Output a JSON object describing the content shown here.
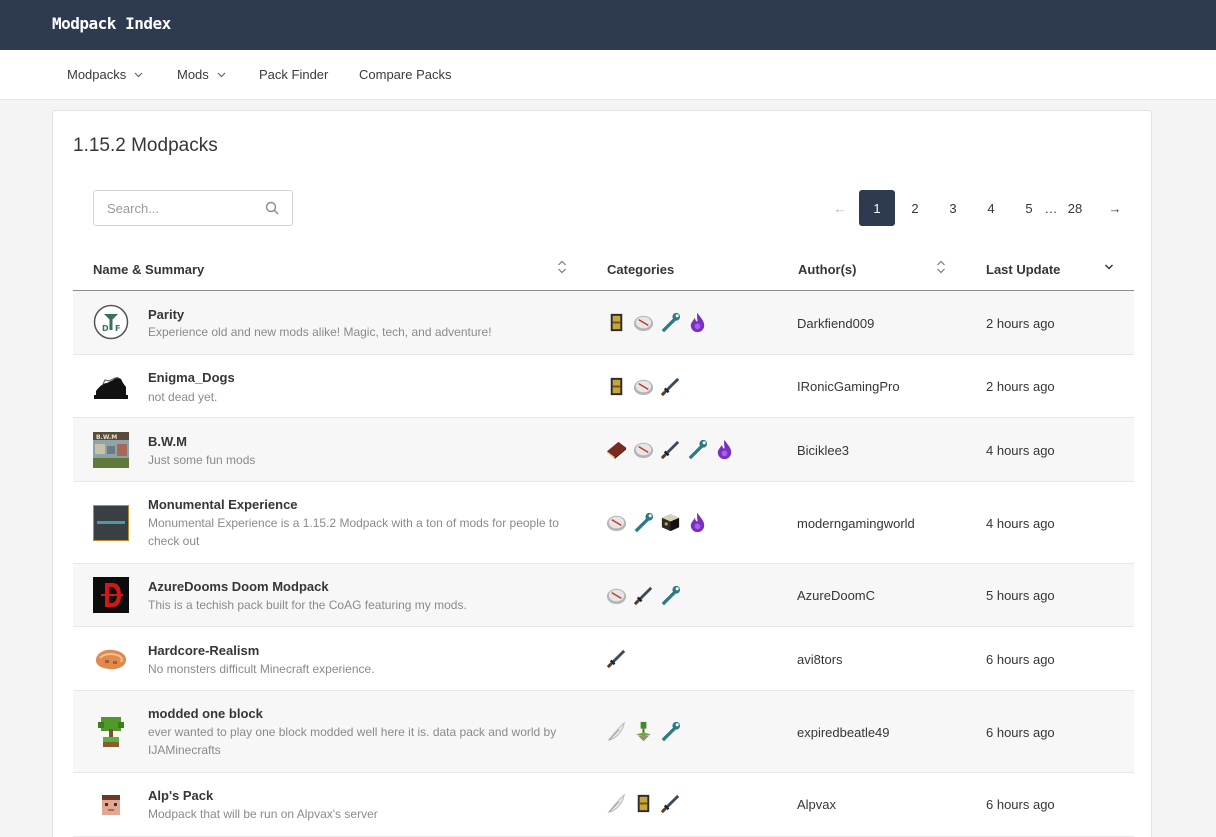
{
  "brand": {
    "logo": "Modpack Index"
  },
  "nav": {
    "modpacks": "Modpacks",
    "mods": "Mods",
    "pack_finder": "Pack Finder",
    "compare": "Compare Packs"
  },
  "page": {
    "title": "1.15.2 Modpacks"
  },
  "search": {
    "placeholder": "Search..."
  },
  "pagination": {
    "prev": "←",
    "pages": [
      "1",
      "2",
      "3",
      "4",
      "5"
    ],
    "ellipsis": "…",
    "last": "28",
    "next": "→",
    "current": "1"
  },
  "table": {
    "columns": {
      "name": "Name & Summary",
      "categories": "Categories",
      "authors": "Author(s)",
      "updated": "Last Update"
    },
    "rows": [
      {
        "name": "Parity",
        "summary": "Experience old and new mods alike! Magic, tech, and adventure!",
        "author": "Darkfiend009",
        "updated": "2 hours ago",
        "categories": [
          "chest-icon",
          "compass-icon",
          "wrench-icon",
          "magic-flame-icon"
        ]
      },
      {
        "name": "Enigma_Dogs",
        "summary": "not dead yet.",
        "author": "IRonicGamingPro",
        "updated": "2 hours ago",
        "categories": [
          "chest-icon",
          "compass-icon",
          "sword-icon"
        ]
      },
      {
        "name": "B.W.M",
        "summary": "Just some fun mods",
        "author": "Biciklee3",
        "updated": "4 hours ago",
        "categories": [
          "book-icon",
          "compass-icon",
          "sword-icon",
          "wrench-icon",
          "magic-flame-icon"
        ]
      },
      {
        "name": "Monumental Experience",
        "summary": "Monumental Experience is a 1.15.2 Modpack with a ton of mods for people to check out",
        "author": "moderngamingworld",
        "updated": "4 hours ago",
        "categories": [
          "compass-icon",
          "wrench-icon",
          "crafting-block-icon",
          "magic-flame-icon"
        ]
      },
      {
        "name": "AzureDooms Doom Modpack",
        "summary": "This is a techish pack built for the CoAG featuring my mods.",
        "author": "AzureDoomC",
        "updated": "5 hours ago",
        "categories": [
          "compass-icon",
          "sword-icon",
          "wrench-icon"
        ]
      },
      {
        "name": "Hardcore-Realism",
        "summary": "No monsters difficult Minecraft experience.",
        "author": "avi8tors",
        "updated": "6 hours ago",
        "categories": [
          "sword-icon"
        ]
      },
      {
        "name": "modded one block",
        "summary": "ever wanted to play one block modded well here it is. data pack and world by IJAMinecrafts",
        "author": "expiredbeatle49",
        "updated": "6 hours ago",
        "categories": [
          "feather-icon",
          "skyblock-island-icon",
          "wrench-icon"
        ]
      },
      {
        "name": "Alp's Pack",
        "summary": "Modpack that will be run on Alpvax's server",
        "author": "Alpvax",
        "updated": "6 hours ago",
        "categories": [
          "feather-icon",
          "chest-icon",
          "sword-icon"
        ]
      }
    ]
  }
}
